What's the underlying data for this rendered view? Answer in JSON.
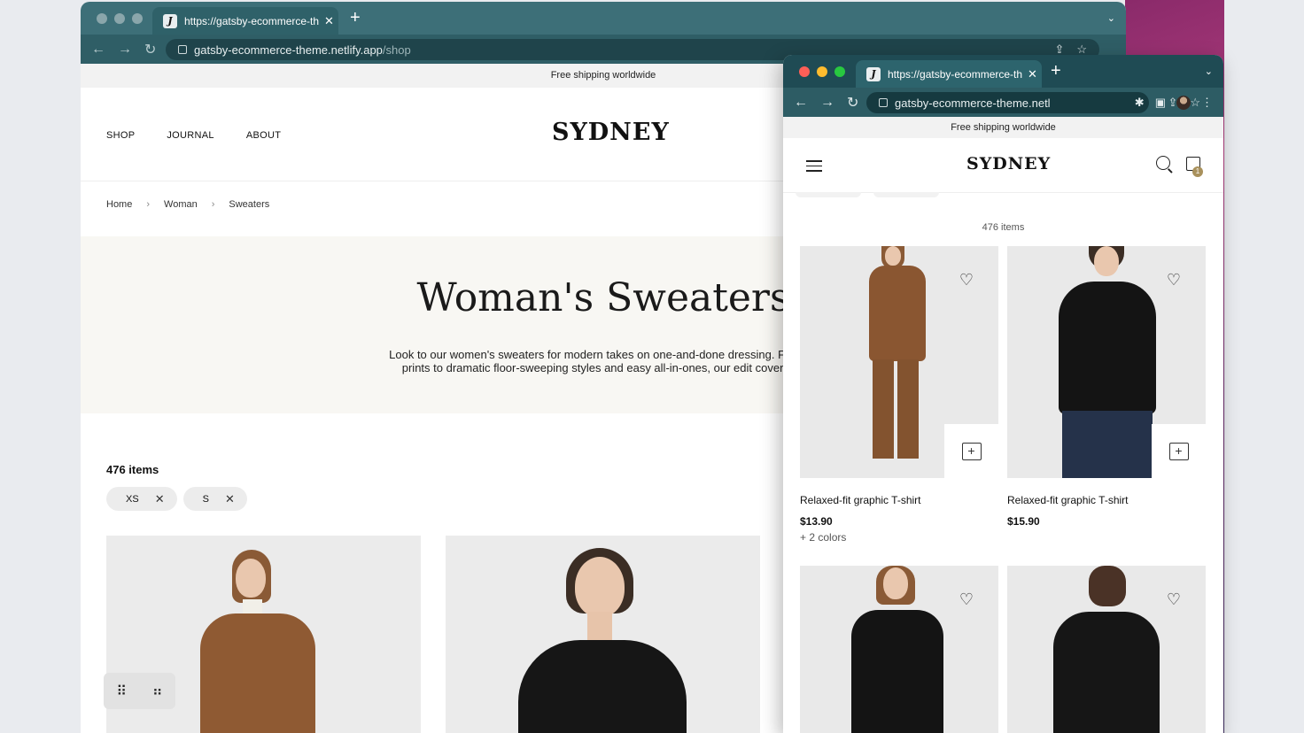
{
  "back_window": {
    "tab": {
      "favicon": "J",
      "title": "https://gatsby-ecommerce-theme.netlify.app/shop"
    },
    "address": {
      "host": "gatsby-ecommerce-theme.netlify.app",
      "path": "/shop"
    },
    "page": {
      "promo": "Free shipping worldwide",
      "nav": [
        "SHOP",
        "JOURNAL",
        "ABOUT"
      ],
      "logo": "SYDNEY",
      "breadcrumbs": [
        "Home",
        "Woman",
        "Sweaters"
      ],
      "hero_title": "Woman's Sweaters",
      "hero_text_line1": "Look to our women's sweaters for modern takes on one-and-done dressing. From m",
      "hero_text_line2": "prints to dramatic floor-sweeping styles and easy all-in-ones, our edit covers ev",
      "item_count": "476 items",
      "filters": [
        "XS",
        "S"
      ]
    }
  },
  "front_window": {
    "tab": {
      "favicon": "J",
      "title": "https://gatsby-ecommerce-theme.netlify.app"
    },
    "address": {
      "host": "gatsby-ecommerce-theme.netl"
    },
    "page": {
      "promo": "Free shipping worldwide",
      "logo": "SYDNEY",
      "cart_count": "1",
      "item_count": "476 items",
      "products": [
        {
          "name": "Relaxed-fit graphic T-shirt",
          "price": "$13.90",
          "colors": "+ 2 colors"
        },
        {
          "name": "Relaxed-fit graphic T-shirt",
          "price": "$15.90",
          "colors": ""
        }
      ]
    }
  },
  "icons": [
    "back-icon",
    "forward-icon",
    "reload-icon",
    "lock-icon",
    "share-icon",
    "star-icon",
    "extension-icon",
    "sidebar-icon",
    "profile-icon",
    "menu-icon",
    "hamburger-icon",
    "search-icon",
    "bag-icon",
    "heart-icon",
    "add-to-bag-icon",
    "close-icon",
    "drag-handle-icon",
    "grid-icon"
  ]
}
